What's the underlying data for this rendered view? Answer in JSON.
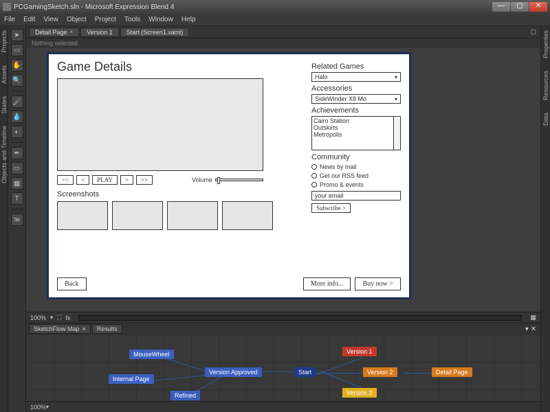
{
  "window": {
    "title": "PCGamingSketch.sln - Microsoft Expression Blend 4"
  },
  "menus": [
    "File",
    "Edit",
    "View",
    "Object",
    "Project",
    "Tools",
    "Window",
    "Help"
  ],
  "left_panel_tabs": [
    "Projects",
    "Assets",
    "States",
    "Objects and Timeline"
  ],
  "right_panel_tabs": [
    "Properties",
    "Resources",
    "Data"
  ],
  "doc_tabs": [
    {
      "label": "Detail Page",
      "closable": true
    },
    {
      "label": "Version 1"
    },
    {
      "label": "Start (Screen1.xaml)"
    }
  ],
  "selection_status": "Nothing selected",
  "artboard": {
    "title": "Game Details",
    "video_controls": [
      "<<",
      "<",
      "PLAY",
      ">",
      ">>"
    ],
    "volume_label": "Volume",
    "screenshots_label": "Screenshots",
    "related_games": {
      "label": "Related Games",
      "value": "Halo"
    },
    "accessories": {
      "label": "Accessories",
      "value": "SideWinder X8 Mo"
    },
    "achievements": {
      "label": "Achievements",
      "items": [
        "Cairo Station",
        "Outskirts",
        "Metropolis"
      ]
    },
    "community": {
      "label": "Community",
      "options": [
        "News by mail",
        "Get our RSS feed",
        "Promo & events"
      ]
    },
    "email_placeholder": "your email",
    "subscribe": "Subscribe >",
    "back": "Back",
    "more_info": "More info...",
    "buy_now": "Buy now >"
  },
  "zoom_main": "100%",
  "sketchflow": {
    "tabs": [
      "SketchFlow Map",
      "Results"
    ],
    "nodes": {
      "mousewheel": "MouseWheel",
      "internal": "Internal Page",
      "approved": "Version Approved",
      "refined": "Refined",
      "start": "Start",
      "v1": "Version 1",
      "v2": "Version 2",
      "v3": "Version 3",
      "detail": "Detail Page"
    },
    "zoom": "100%"
  }
}
